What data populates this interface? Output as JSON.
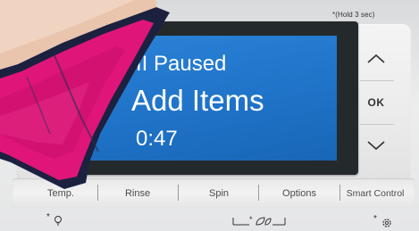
{
  "hint_top": "*(Hold 3 sec)",
  "display": {
    "status": "II Paused",
    "message": "Add Items",
    "time": "0:47"
  },
  "side_buttons": [
    {
      "name": "up",
      "icon": "chevron-up-icon"
    },
    {
      "name": "ok",
      "label": "OK"
    },
    {
      "name": "down",
      "icon": "chevron-down-icon"
    }
  ],
  "bottom_buttons": [
    {
      "label": "Temp."
    },
    {
      "label": "Rinse"
    },
    {
      "label": "Spin"
    },
    {
      "label": "Options"
    },
    {
      "label": "Smart Control"
    }
  ],
  "below_icons": [
    {
      "icon": "bulb-icon",
      "marker": "*"
    },
    {
      "icon": "leaf-icon",
      "marker": "*"
    },
    {
      "icon": "gear-icon",
      "marker": "*"
    }
  ],
  "colors": {
    "screen": "#1f73c8",
    "screen_text": "#ffffff",
    "cloth_pink": "#e0157a",
    "cloth_navy": "#1c2140"
  }
}
